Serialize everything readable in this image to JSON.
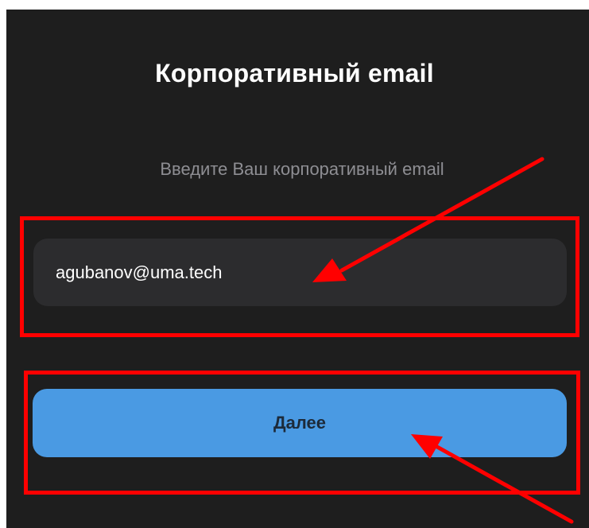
{
  "header": {
    "title": "Корпоративный email"
  },
  "form": {
    "instruction": "Введите Ваш корпоративный email",
    "email_value": "agubanov@uma.tech",
    "next_label": "Далее"
  },
  "colors": {
    "background": "#1e1e1e",
    "input_background": "#2c2c2e",
    "button_background": "#4a9ae3",
    "annotation": "#ff0000"
  }
}
